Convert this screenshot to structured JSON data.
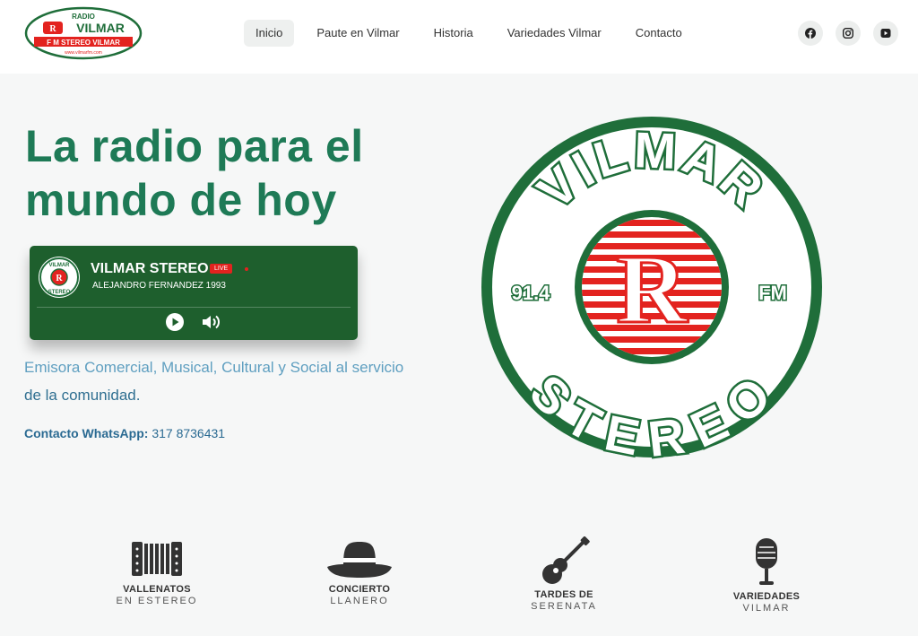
{
  "header": {
    "logo": {
      "top_text": "RADIO",
      "main_text": "VILMAR",
      "band_text": "F M STEREO VILMAR",
      "url_text": "www.vilmarfm.com"
    },
    "nav": [
      {
        "label": "Inicio",
        "active": true
      },
      {
        "label": "Paute en Vilmar",
        "active": false
      },
      {
        "label": "Historia",
        "active": false
      },
      {
        "label": "Variedades Vilmar",
        "active": false
      },
      {
        "label": "Contacto",
        "active": false
      }
    ],
    "socials": [
      "facebook-icon",
      "instagram-icon",
      "youtube-icon"
    ]
  },
  "hero": {
    "title": "La radio para el mundo de hoy",
    "description_part1": "Emisora Comercial, Musical, Cultural y Social al servicio",
    "description_part2": "de la comunidad.",
    "contact_label": "Contacto WhatsApp:",
    "contact_number": "317 8736431"
  },
  "player": {
    "title": "VILMAR STEREO",
    "live_badge": "LIVE",
    "subtitle": "ALEJANDRO FERNANDEZ 1993",
    "logo_top": "VILMAR",
    "logo_bottom": "STEREO"
  },
  "big_logo": {
    "top_text": "VILMAR",
    "bottom_text": "STEREO",
    "left_text": "91.4",
    "right_text": "FM"
  },
  "features": [
    {
      "title": "VALLENATOS",
      "subtitle": "EN ESTEREO",
      "icon": "accordion-icon"
    },
    {
      "title": "CONCIERTO",
      "subtitle": "LLANERO",
      "icon": "hat-icon"
    },
    {
      "title": "TARDES DE",
      "subtitle": "SERENATA",
      "icon": "guitar-icon"
    },
    {
      "title": "VARIEDADES",
      "subtitle": "VILMAR",
      "icon": "microphone-icon"
    }
  ],
  "colors": {
    "brand_green": "#1e7a56",
    "player_green": "#1e5f2d",
    "logo_green": "#1f6e3a",
    "logo_red": "#e3231f",
    "text_blue": "#5f9fc0"
  }
}
